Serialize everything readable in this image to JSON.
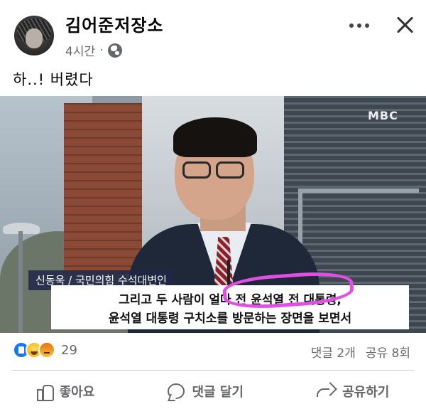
{
  "post": {
    "author": "김어준저장소",
    "time": "4시간",
    "dot": "·",
    "text": "하..! 버렸다"
  },
  "image": {
    "mbc_logo": "MBC",
    "caption_label": "신동욱 / 국민의힘 수석대변인",
    "caption_line1": "그리고 두 사람이 얼마 전 윤석열 전 대통령,",
    "caption_line2": "윤석열 대통령 구치소를 방문하는 장면을 보면서",
    "highlight_color": "#e04ee6"
  },
  "reactions": {
    "icons": [
      "like-icon",
      "haha-icon",
      "angry-icon"
    ],
    "count": "29"
  },
  "stats": {
    "comments": "댓글 2개",
    "shares": "공유 8회"
  },
  "actions": {
    "like": "좋아요",
    "comment": "댓글 달기",
    "share": "공유하기"
  },
  "colors": {
    "secondary_text": "#65676b",
    "like_blue": "#1877f2"
  }
}
